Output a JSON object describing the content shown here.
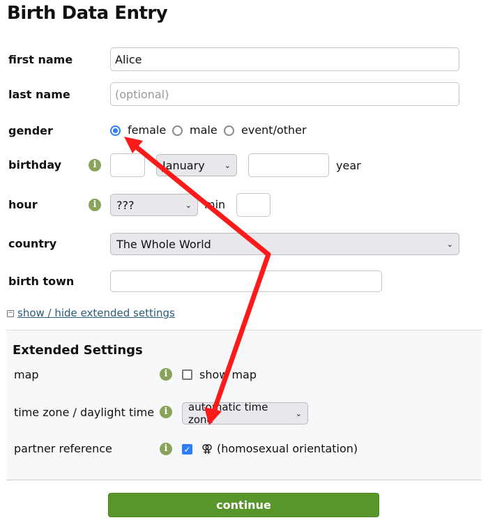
{
  "title": "Birth Data Entry",
  "fields": {
    "first_name": {
      "label": "first name",
      "value": "Alice"
    },
    "last_name": {
      "label": "last name",
      "placeholder": "(optional)"
    },
    "gender": {
      "label": "gender",
      "options": [
        "female",
        "male",
        "event/other"
      ],
      "selected": "female"
    },
    "birthday": {
      "label": "birthday",
      "month": "January",
      "year_label": "year"
    },
    "hour": {
      "label": "hour",
      "value": "???",
      "min_label": "min"
    },
    "country": {
      "label": "country",
      "value": "The Whole World"
    },
    "birth_town": {
      "label": "birth town"
    }
  },
  "toggle_link": "show / hide extended settings",
  "toggle_icon": "minus-box-icon",
  "extended": {
    "title": "Extended Settings",
    "map": {
      "label": "map",
      "checkbox_label": "show map",
      "checked": false
    },
    "timezone": {
      "label": "time zone / daylight time",
      "value": "automatic time zone"
    },
    "partner": {
      "label": "partner reference",
      "symbol": "⚢",
      "checkbox_label": "(homosexual orientation)",
      "checked": true
    }
  },
  "continue_label": "continue",
  "colors": {
    "accent": "#2d7ff9",
    "button": "#58962b",
    "info": "#8aa35a",
    "annotation": "#ff0000"
  }
}
